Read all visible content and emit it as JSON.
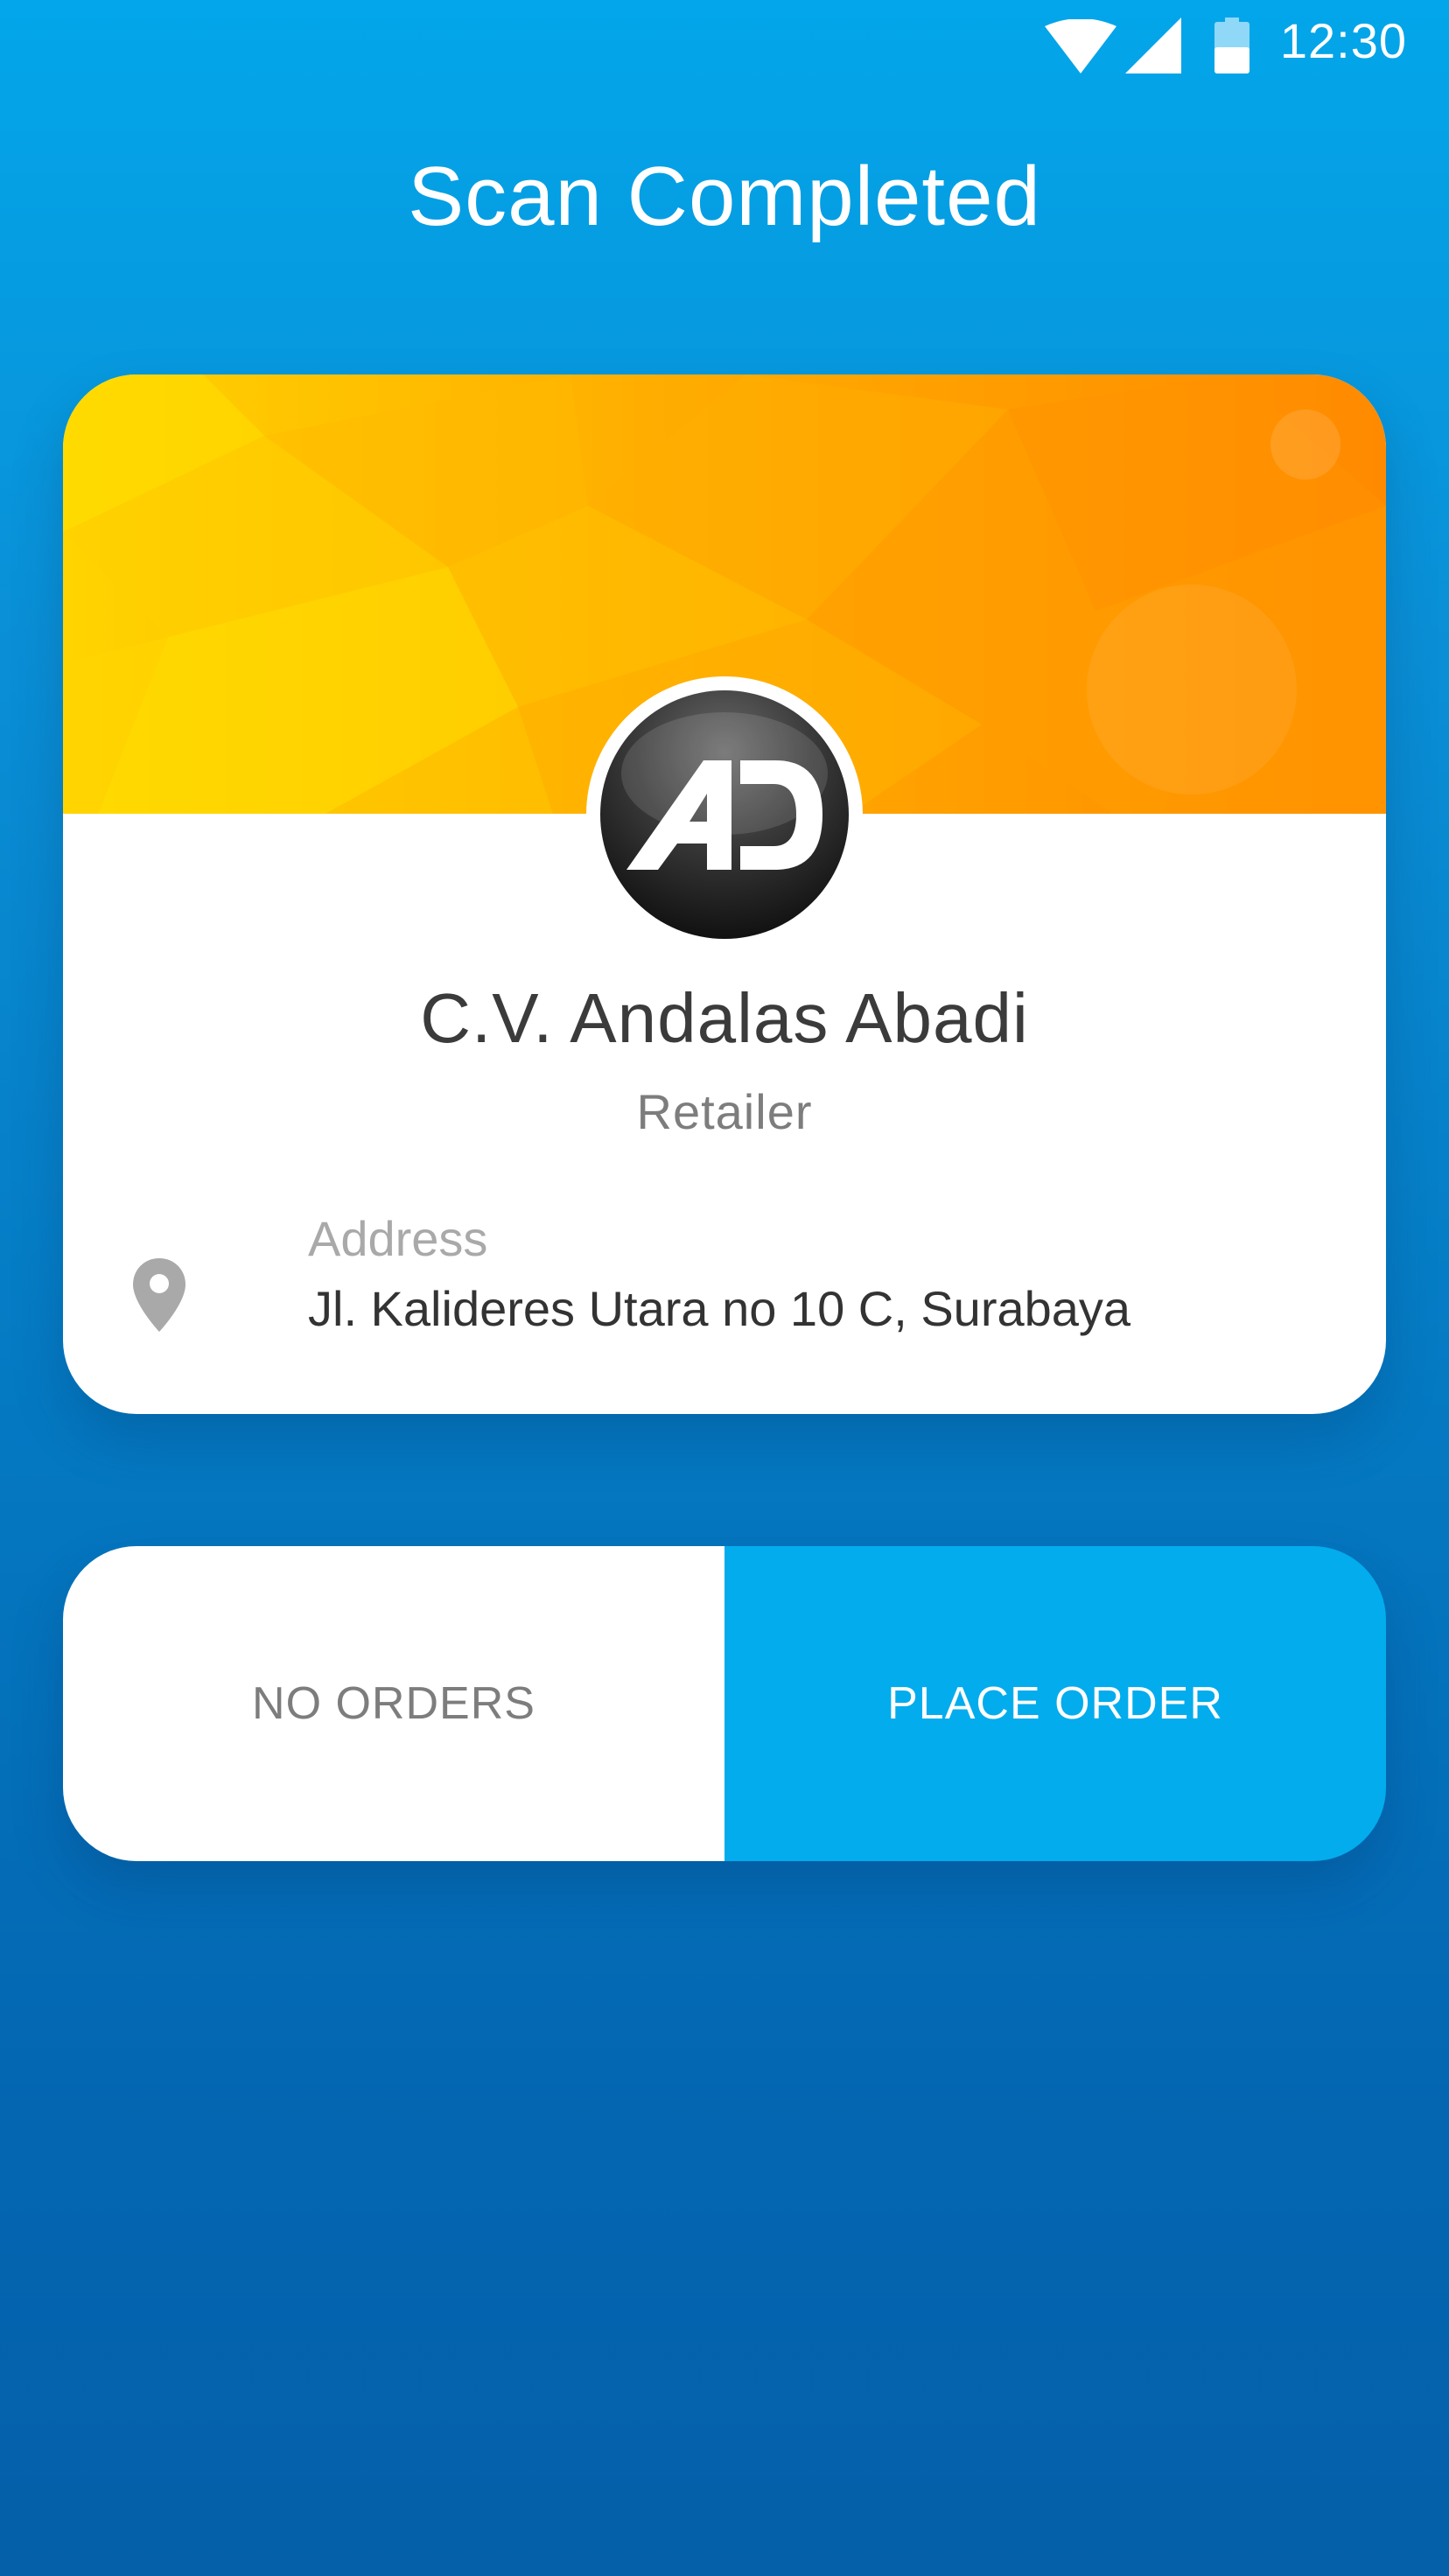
{
  "status_bar": {
    "time": "12:30",
    "wifi_icon": "wifi-icon",
    "signal_icon": "cell-signal-icon",
    "battery_icon": "battery-icon"
  },
  "header": {
    "title": "Scan Completed"
  },
  "card": {
    "logo_icon": "company-logo-ad",
    "company_name": "C.V. Andalas Abadi",
    "company_type": "Retailer",
    "address": {
      "icon": "location-pin-icon",
      "label": "Address",
      "value": "Jl. Kalideres Utara no 10 C, Surabaya"
    }
  },
  "actions": {
    "no_orders_label": "NO ORDERS",
    "place_order_label": "PLACE ORDER"
  },
  "colors": {
    "background_top": "#03a6ea",
    "background_bottom": "#055fa9",
    "accent": "#03aced",
    "banner_yellow": "#ffd200",
    "banner_orange": "#ff8a00"
  }
}
